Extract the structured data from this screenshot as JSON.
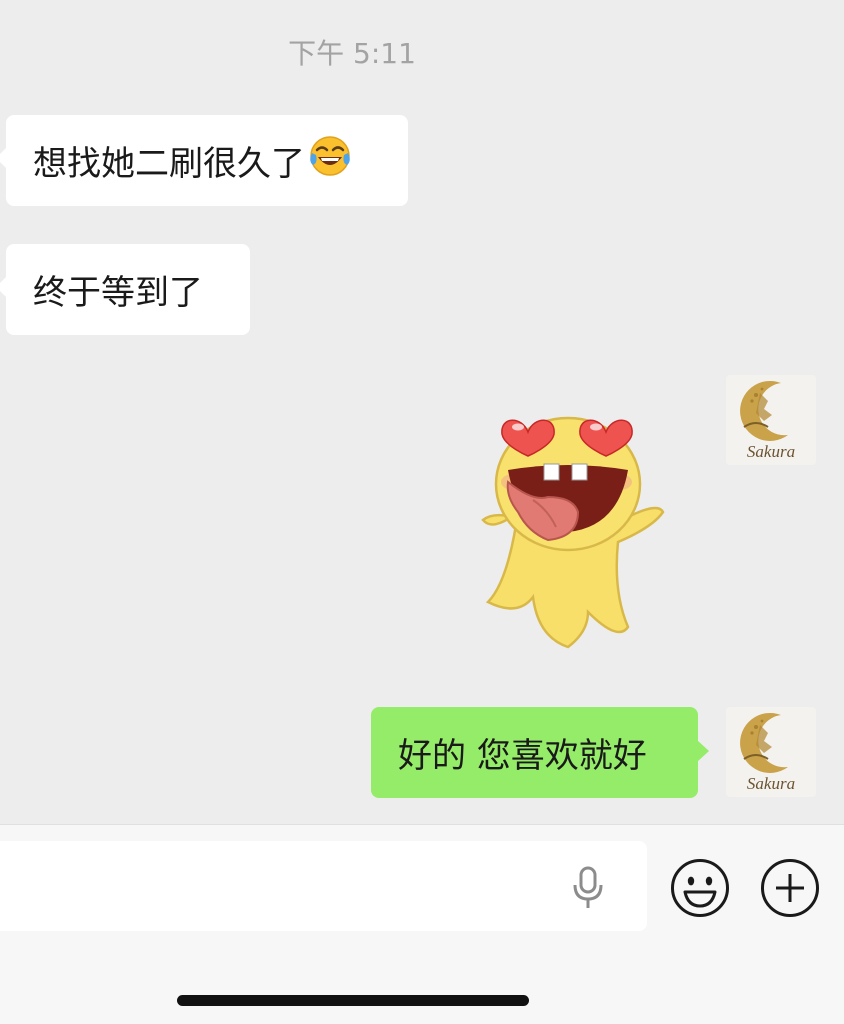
{
  "chat": {
    "timestamp": "下午 5:11",
    "messages": [
      {
        "direction": "incoming",
        "text": "想找她二刷很久了",
        "emoji": "tears-of-joy"
      },
      {
        "direction": "incoming",
        "text": "终于等到了"
      },
      {
        "direction": "outgoing",
        "type": "sticker",
        "sticker": "heart-eyes-tongue-out-sticker"
      },
      {
        "direction": "outgoing",
        "text": "好的 您喜欢就好"
      }
    ],
    "avatar_label": "Sakura"
  },
  "input_bar": {
    "icons": [
      "microphone-icon",
      "smiley-icon",
      "plus-icon"
    ]
  },
  "colors": {
    "background": "#ededed",
    "incoming_bubble": "#ffffff",
    "outgoing_bubble": "#95ec69"
  }
}
